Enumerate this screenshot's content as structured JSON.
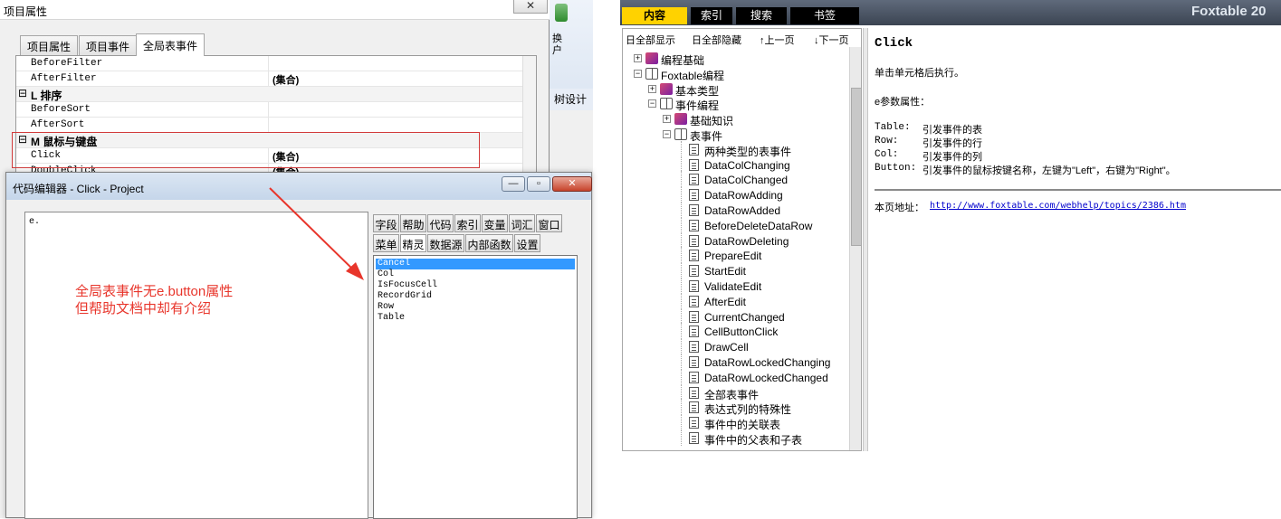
{
  "project_window": {
    "title": "项目属性",
    "close_label": "✕",
    "tabs": [
      {
        "label": "项目属性"
      },
      {
        "label": "项目事件"
      },
      {
        "label": "全局表事件",
        "active": true
      }
    ],
    "property_rows": [
      {
        "kind": "prop",
        "name": "BeforeFilter",
        "value": ""
      },
      {
        "kind": "prop",
        "name": "AfterFilter",
        "value": "(集合)"
      },
      {
        "kind": "group",
        "expander": "⊟",
        "name": "L 排序"
      },
      {
        "kind": "prop",
        "name": "BeforeSort",
        "value": ""
      },
      {
        "kind": "prop",
        "name": "AfterSort",
        "value": ""
      },
      {
        "kind": "group",
        "expander": "⊟",
        "name": "M 鼠标与键盘"
      },
      {
        "kind": "prop",
        "name": "Click",
        "value": "(集合)"
      },
      {
        "kind": "prop",
        "name": "DoubleClick",
        "value": "(集合)"
      }
    ]
  },
  "ribbon": {
    "huan_label": "换\n户",
    "design_label": "树设计"
  },
  "code_editor": {
    "title": "代码编辑器 - Click - Project",
    "min_label": "—",
    "max_label": "▫",
    "close_label": "✕",
    "code_text": "e.",
    "annotation_line1": "全局表事件无e.button属性",
    "annotation_line2": "但帮助文档中却有介绍",
    "tabs_row1": [
      "字段",
      "帮助",
      "代码",
      "索引",
      "变量",
      "词汇",
      "窗口"
    ],
    "tabs_row2": [
      "菜单",
      "精灵",
      "数据源",
      "内部函数",
      "设置"
    ],
    "active_tab": "精灵",
    "sprite_items": [
      "Cancel",
      "Col",
      "IsFocusCell",
      "RecordGrid",
      "Row",
      "Table"
    ],
    "selected_item": "Cancel"
  },
  "help_viewer": {
    "tabs": [
      {
        "label": "内容",
        "active": true
      },
      {
        "label": "索引"
      },
      {
        "label": "搜索"
      },
      {
        "label": "书签"
      }
    ],
    "brand": "Foxtable 20",
    "toolbar": {
      "show_all": "日全部显示",
      "hide_all": "日全部隐藏",
      "prev": "↑上一页",
      "next": "↓下一页"
    },
    "toc": [
      {
        "label": "编程基础",
        "level": 0,
        "kind": "book-closed",
        "expander": "+"
      },
      {
        "label": "Foxtable编程",
        "level": 0,
        "kind": "book-open",
        "expander": "−"
      },
      {
        "label": "基本类型",
        "level": 1,
        "kind": "book-closed",
        "expander": "+"
      },
      {
        "label": "事件编程",
        "level": 1,
        "kind": "book-open",
        "expander": "−"
      },
      {
        "label": "基础知识",
        "level": 2,
        "kind": "book-closed",
        "expander": "+"
      },
      {
        "label": "表事件",
        "level": 2,
        "kind": "book-open",
        "expander": "−"
      },
      {
        "label": "两种类型的表事件",
        "level": 3,
        "kind": "page"
      },
      {
        "label": "DataColChanging",
        "level": 3,
        "kind": "page"
      },
      {
        "label": "DataColChanged",
        "level": 3,
        "kind": "page"
      },
      {
        "label": "DataRowAdding",
        "level": 3,
        "kind": "page"
      },
      {
        "label": "DataRowAdded",
        "level": 3,
        "kind": "page"
      },
      {
        "label": "BeforeDeleteDataRow",
        "level": 3,
        "kind": "page"
      },
      {
        "label": "DataRowDeleting",
        "level": 3,
        "kind": "page"
      },
      {
        "label": "PrepareEdit",
        "level": 3,
        "kind": "page"
      },
      {
        "label": "StartEdit",
        "level": 3,
        "kind": "page"
      },
      {
        "label": "ValidateEdit",
        "level": 3,
        "kind": "page"
      },
      {
        "label": "AfterEdit",
        "level": 3,
        "kind": "page"
      },
      {
        "label": "CurrentChanged",
        "level": 3,
        "kind": "page"
      },
      {
        "label": "CellButtonClick",
        "level": 3,
        "kind": "page"
      },
      {
        "label": "DrawCell",
        "level": 3,
        "kind": "page"
      },
      {
        "label": "DataRowLockedChanging",
        "level": 3,
        "kind": "page"
      },
      {
        "label": "DataRowLockedChanged",
        "level": 3,
        "kind": "page"
      },
      {
        "label": "全部表事件",
        "level": 3,
        "kind": "page"
      },
      {
        "label": "表达式列的特殊性",
        "level": 3,
        "kind": "page"
      },
      {
        "label": "事件中的关联表",
        "level": 3,
        "kind": "page"
      },
      {
        "label": "事件中的父表和子表",
        "level": 3,
        "kind": "page"
      }
    ],
    "page": {
      "title": "Click",
      "desc": "单击单元格后执行。",
      "params_heading": "e参数属性：",
      "params": [
        {
          "name": "Table:",
          "text": "引发事件的表"
        },
        {
          "name": "Row:",
          "text": "引发事件的行"
        },
        {
          "name": "Col:",
          "text": "引发事件的列"
        },
        {
          "name": "Button:",
          "text": "引发事件的鼠标按键名称，左键为\"Left\"，右键为\"Right\"。"
        }
      ],
      "url_label": "本页地址：",
      "url": "http://www.foxtable.com/webhelp/topics/2386.htm"
    }
  }
}
